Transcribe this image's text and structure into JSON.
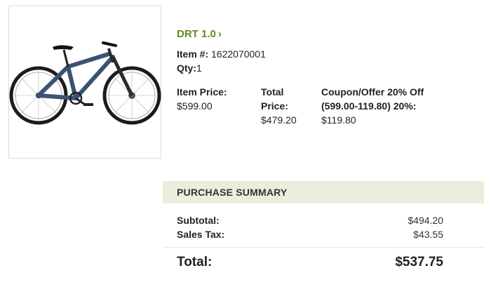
{
  "product": {
    "image_alt": "bicycle-image",
    "name": "DRT 1.0",
    "name_chevron": "›",
    "item_label": "Item #:",
    "item_number": "1622070001",
    "qty_label": "Qty:",
    "qty_value": "1",
    "item_price_label": "Item Price:",
    "item_price_value": "$599.00",
    "total_price_label_1": "Total",
    "total_price_label_2": "Price:",
    "total_price_value": "$479.20",
    "coupon_label_1": "Coupon/Offer 20% Off",
    "coupon_label_2": "(599.00-119.80) 20%:",
    "coupon_value": "$119.80"
  },
  "summary": {
    "header": "PURCHASE SUMMARY",
    "subtotal_label": "Subtotal:",
    "subtotal_value": "$494.20",
    "tax_label": "Sales Tax:",
    "tax_value": "$43.55",
    "total_label": "Total:",
    "total_value": "$537.75"
  },
  "colors": {
    "link_green": "#5f8a1e",
    "summary_header_bg": "#ededde",
    "bike_frame": "#3b5273"
  }
}
